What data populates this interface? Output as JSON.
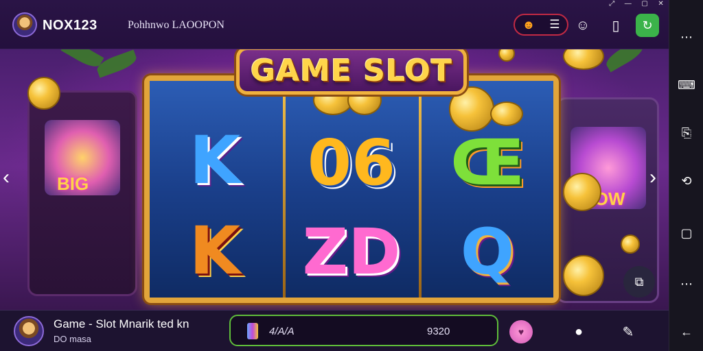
{
  "header": {
    "app_name": "NOX123",
    "page_caption": "Pohhnwo LAOOPON",
    "menu_pill": {
      "icon": "user-icon",
      "menu_icon": "hamburger-icon"
    },
    "right_icons": [
      "face-icon",
      "phone-icon",
      "refresh-icon"
    ],
    "window_controls": [
      "resize-icon",
      "minimize-icon",
      "maximize-icon",
      "close-icon"
    ]
  },
  "game": {
    "title": "GAME SLOT",
    "reels": [
      {
        "top": "K",
        "bottom": "K"
      },
      {
        "top": "06",
        "bottom": "ZD"
      },
      {
        "top": "Œ",
        "bottom": "Q"
      }
    ],
    "arcade_left_text": "BIG",
    "arcade_right_text": "NOW",
    "nav_left": "‹",
    "nav_right": "›"
  },
  "footer": {
    "title": "Game - Slot Mnarik ted kn",
    "subtitle": "DO masa",
    "stat_a": "4/A/A",
    "stat_b": "9320",
    "icons": [
      "pig-icon",
      "chat-icon",
      "share-icon"
    ]
  },
  "sidebar": {
    "items": [
      "more-icon",
      "keyboard-icon",
      "screenshot-icon",
      "rotate-icon",
      "window-icon",
      "more-icon",
      "back-icon"
    ]
  },
  "colors": {
    "accent_gold": "#e2a53a",
    "accent_green": "#3bb34a",
    "accent_red": "#c22a44",
    "background": "#1a0b2e"
  }
}
